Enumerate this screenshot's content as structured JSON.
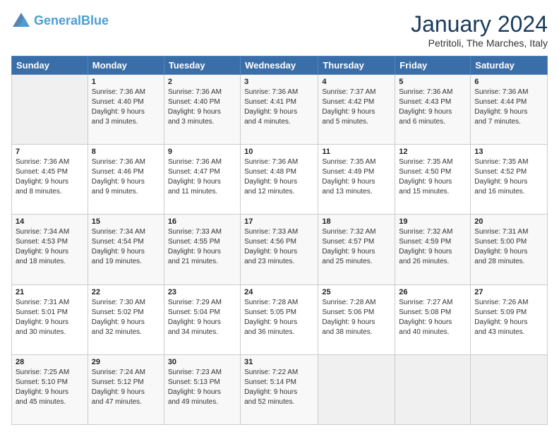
{
  "logo": {
    "line1": "General",
    "line2": "Blue"
  },
  "title": "January 2024",
  "location": "Petritoli, The Marches, Italy",
  "headers": [
    "Sunday",
    "Monday",
    "Tuesday",
    "Wednesday",
    "Thursday",
    "Friday",
    "Saturday"
  ],
  "weeks": [
    [
      {
        "num": "",
        "info": ""
      },
      {
        "num": "1",
        "info": "Sunrise: 7:36 AM\nSunset: 4:40 PM\nDaylight: 9 hours\nand 3 minutes."
      },
      {
        "num": "2",
        "info": "Sunrise: 7:36 AM\nSunset: 4:40 PM\nDaylight: 9 hours\nand 3 minutes."
      },
      {
        "num": "3",
        "info": "Sunrise: 7:36 AM\nSunset: 4:41 PM\nDaylight: 9 hours\nand 4 minutes."
      },
      {
        "num": "4",
        "info": "Sunrise: 7:37 AM\nSunset: 4:42 PM\nDaylight: 9 hours\nand 5 minutes."
      },
      {
        "num": "5",
        "info": "Sunrise: 7:36 AM\nSunset: 4:43 PM\nDaylight: 9 hours\nand 6 minutes."
      },
      {
        "num": "6",
        "info": "Sunrise: 7:36 AM\nSunset: 4:44 PM\nDaylight: 9 hours\nand 7 minutes."
      }
    ],
    [
      {
        "num": "7",
        "info": "Sunrise: 7:36 AM\nSunset: 4:45 PM\nDaylight: 9 hours\nand 8 minutes."
      },
      {
        "num": "8",
        "info": "Sunrise: 7:36 AM\nSunset: 4:46 PM\nDaylight: 9 hours\nand 9 minutes."
      },
      {
        "num": "9",
        "info": "Sunrise: 7:36 AM\nSunset: 4:47 PM\nDaylight: 9 hours\nand 11 minutes."
      },
      {
        "num": "10",
        "info": "Sunrise: 7:36 AM\nSunset: 4:48 PM\nDaylight: 9 hours\nand 12 minutes."
      },
      {
        "num": "11",
        "info": "Sunrise: 7:35 AM\nSunset: 4:49 PM\nDaylight: 9 hours\nand 13 minutes."
      },
      {
        "num": "12",
        "info": "Sunrise: 7:35 AM\nSunset: 4:50 PM\nDaylight: 9 hours\nand 15 minutes."
      },
      {
        "num": "13",
        "info": "Sunrise: 7:35 AM\nSunset: 4:52 PM\nDaylight: 9 hours\nand 16 minutes."
      }
    ],
    [
      {
        "num": "14",
        "info": "Sunrise: 7:34 AM\nSunset: 4:53 PM\nDaylight: 9 hours\nand 18 minutes."
      },
      {
        "num": "15",
        "info": "Sunrise: 7:34 AM\nSunset: 4:54 PM\nDaylight: 9 hours\nand 19 minutes."
      },
      {
        "num": "16",
        "info": "Sunrise: 7:33 AM\nSunset: 4:55 PM\nDaylight: 9 hours\nand 21 minutes."
      },
      {
        "num": "17",
        "info": "Sunrise: 7:33 AM\nSunset: 4:56 PM\nDaylight: 9 hours\nand 23 minutes."
      },
      {
        "num": "18",
        "info": "Sunrise: 7:32 AM\nSunset: 4:57 PM\nDaylight: 9 hours\nand 25 minutes."
      },
      {
        "num": "19",
        "info": "Sunrise: 7:32 AM\nSunset: 4:59 PM\nDaylight: 9 hours\nand 26 minutes."
      },
      {
        "num": "20",
        "info": "Sunrise: 7:31 AM\nSunset: 5:00 PM\nDaylight: 9 hours\nand 28 minutes."
      }
    ],
    [
      {
        "num": "21",
        "info": "Sunrise: 7:31 AM\nSunset: 5:01 PM\nDaylight: 9 hours\nand 30 minutes."
      },
      {
        "num": "22",
        "info": "Sunrise: 7:30 AM\nSunset: 5:02 PM\nDaylight: 9 hours\nand 32 minutes."
      },
      {
        "num": "23",
        "info": "Sunrise: 7:29 AM\nSunset: 5:04 PM\nDaylight: 9 hours\nand 34 minutes."
      },
      {
        "num": "24",
        "info": "Sunrise: 7:28 AM\nSunset: 5:05 PM\nDaylight: 9 hours\nand 36 minutes."
      },
      {
        "num": "25",
        "info": "Sunrise: 7:28 AM\nSunset: 5:06 PM\nDaylight: 9 hours\nand 38 minutes."
      },
      {
        "num": "26",
        "info": "Sunrise: 7:27 AM\nSunset: 5:08 PM\nDaylight: 9 hours\nand 40 minutes."
      },
      {
        "num": "27",
        "info": "Sunrise: 7:26 AM\nSunset: 5:09 PM\nDaylight: 9 hours\nand 43 minutes."
      }
    ],
    [
      {
        "num": "28",
        "info": "Sunrise: 7:25 AM\nSunset: 5:10 PM\nDaylight: 9 hours\nand 45 minutes."
      },
      {
        "num": "29",
        "info": "Sunrise: 7:24 AM\nSunset: 5:12 PM\nDaylight: 9 hours\nand 47 minutes."
      },
      {
        "num": "30",
        "info": "Sunrise: 7:23 AM\nSunset: 5:13 PM\nDaylight: 9 hours\nand 49 minutes."
      },
      {
        "num": "31",
        "info": "Sunrise: 7:22 AM\nSunset: 5:14 PM\nDaylight: 9 hours\nand 52 minutes."
      },
      {
        "num": "",
        "info": ""
      },
      {
        "num": "",
        "info": ""
      },
      {
        "num": "",
        "info": ""
      }
    ]
  ]
}
